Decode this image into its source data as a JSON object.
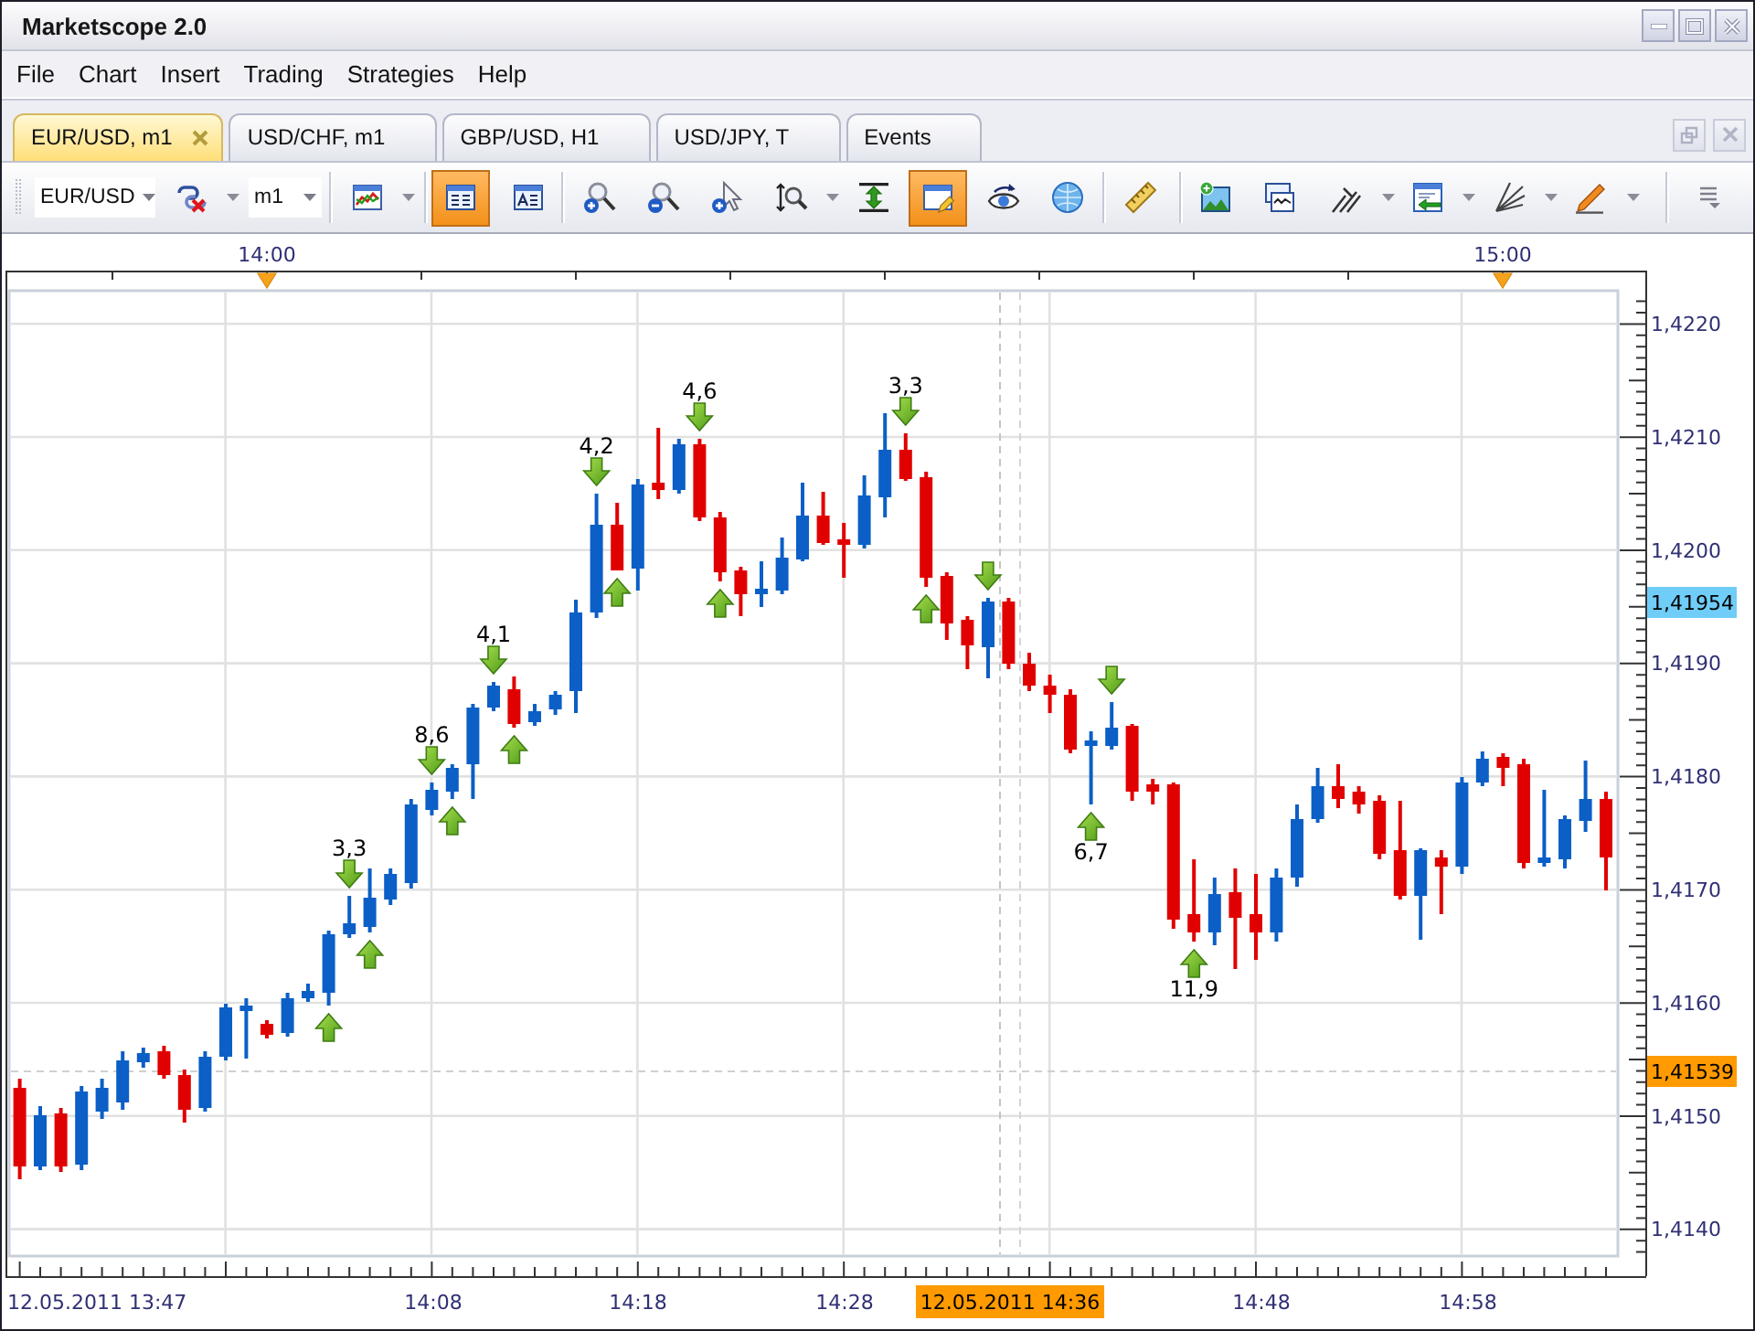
{
  "window": {
    "title": "Marketscope 2.0"
  },
  "menu": [
    "File",
    "Chart",
    "Insert",
    "Trading",
    "Strategies",
    "Help"
  ],
  "tabs": [
    {
      "label": "EUR/USD, m1",
      "selected": true
    },
    {
      "label": "USD/CHF, m1",
      "selected": false
    },
    {
      "label": "GBP/USD, H1",
      "selected": false
    },
    {
      "label": "USD/JPY, T",
      "selected": false
    },
    {
      "label": "Events",
      "selected": false
    }
  ],
  "toolbar": {
    "symbol": "EUR/USD",
    "timeframe": "m1",
    "buttons": [
      {
        "on": false
      },
      {
        "on": false
      },
      {
        "on": true
      },
      {
        "on": false
      },
      {
        "on": false
      },
      {
        "on": false
      },
      {
        "on": false
      },
      {
        "on": false
      },
      {
        "on": false
      },
      {
        "on": true
      },
      {
        "on": false
      },
      {
        "on": false
      },
      {
        "on": false
      },
      {
        "on": false
      },
      {
        "on": false
      },
      {
        "on": false
      },
      {
        "on": false
      },
      {
        "on": false
      },
      {
        "on": false
      }
    ]
  },
  "chart": {
    "top_axis": [
      "14:00",
      "15:00"
    ],
    "price_axis": [
      "1,4220",
      "1,4210",
      "1,4200",
      "1,4190",
      "1,4180",
      "1,4170",
      "1,4160",
      "1,4150",
      "1,4140"
    ],
    "current_price": "1,41954",
    "cursor_price": "1,41539",
    "time_axis": [
      "12.05.2011 13:47",
      "14:08",
      "14:18",
      "14:28",
      "14:48",
      "14:58"
    ],
    "cursor_time": "12.05.2011 14:36",
    "signals": [
      {
        "kind": "buy"
      },
      {
        "kind": "sell",
        "label": "3,3"
      },
      {
        "kind": "buy"
      },
      {
        "kind": "sell",
        "label": "8,6"
      },
      {
        "kind": "buy"
      },
      {
        "kind": "sell",
        "label": "4,1"
      },
      {
        "kind": "buy"
      },
      {
        "kind": "sell",
        "label": "4,2"
      },
      {
        "kind": "buy"
      },
      {
        "kind": "sell",
        "label": "4,6"
      },
      {
        "kind": "buy"
      },
      {
        "kind": "sell",
        "label": "3,3"
      },
      {
        "kind": "buy"
      },
      {
        "kind": "sell"
      },
      {
        "kind": "buy",
        "label": "6,7"
      },
      {
        "kind": "sell"
      },
      {
        "kind": "buy",
        "label": "11,9"
      }
    ]
  }
}
